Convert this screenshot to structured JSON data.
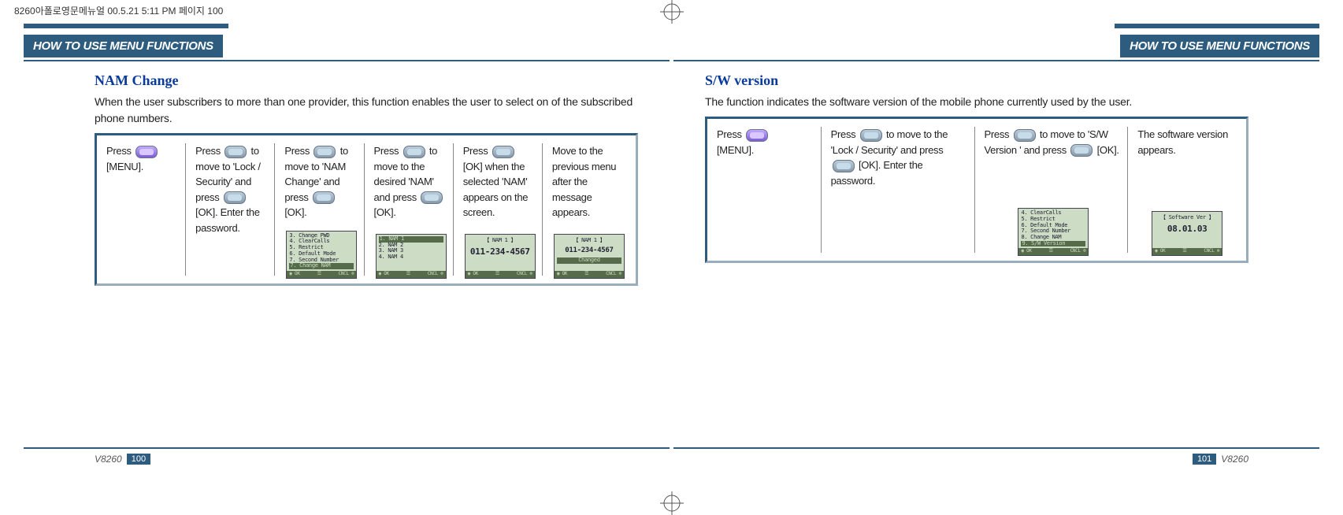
{
  "cropmark": "8260아폴로영문메뉴얼   00.5.21 5:11 PM  페이지 100",
  "header_label": "HOW TO USE MENU FUNCTIONS",
  "left": {
    "title": "NAM Change",
    "desc": "When the user subscribers to more than one provider, this  function enables the user to select on of the subscribed phone numbers.",
    "steps": [
      {
        "t": "Press ",
        "t2": "[MENU]."
      },
      {
        "t": "Press ",
        "t2": " to move to  'Lock / Security' and press ",
        "t3": "[OK]. Enter the password."
      },
      {
        "t": "Press ",
        "t2": " to move to  'NAM Change'  and press ",
        "t3": "[OK]."
      },
      {
        "t": "Press ",
        "t2": " to move to the desired  'NAM' and press ",
        "t3": "[OK]."
      },
      {
        "t": "Press ",
        "t2": "[OK] when the  selected  'NAM' appears on the  screen."
      },
      {
        "t": "Move to the previous menu after the message appears."
      }
    ],
    "screens": [
      {
        "lines": [
          "3.  Change PWD",
          "4.  ClearCalls",
          "5.  Restrict",
          "6.  Default  Mode",
          "7.  Second  Number"
        ],
        "hl": "7.  Change  NAM"
      },
      {
        "hl": "1.  NAM 1",
        "lines": [
          "2.  NAM 2",
          "3.  NAM 3",
          "4.  NAM 4"
        ]
      },
      {
        "title": "【  NAM 1  】",
        "big": "011-234-4567"
      },
      {
        "title": "【  NAM 1  】",
        "big": "011-234-4567",
        "sub": "Changed"
      }
    ],
    "foot_ok": "OK",
    "foot_cncl": "CNCL",
    "model": "V8260",
    "page": "100"
  },
  "right": {
    "title": "S/W version",
    "desc": "The function indicates the software version  of the mobile phone currently  used by the user.",
    "steps": [
      {
        "t": "Press ",
        "t2": "[MENU]."
      },
      {
        "t": "Press ",
        "t2": " to move to the 'Lock / Security' and press ",
        "t3": "[OK]. Enter the password."
      },
      {
        "t": "Press ",
        "t2": " to move to  'S/W Version ' and press ",
        "t3": "[OK]."
      },
      {
        "t": "The software version appears."
      }
    ],
    "screens": [
      {
        "lines": [
          "4.  ClearCalls",
          "5.  Restrict",
          "6.  Default  Mode",
          "7.  Second  Number",
          "8.  Change  NAM"
        ],
        "hl": "9.  S/W Version"
      },
      {
        "title": "【 Software  Ver 】",
        "big": "08.01.03"
      }
    ],
    "foot_ok": "OK",
    "foot_cncl": "CNCL",
    "model": "V8260",
    "page": "101"
  }
}
